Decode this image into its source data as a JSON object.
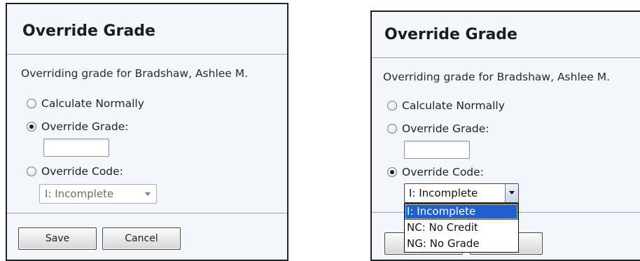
{
  "dialog_left": {
    "title": "Override Grade",
    "description": "Overriding grade for Bradshaw, Ashlee M.",
    "options": [
      {
        "label": "Calculate Normally",
        "checked": false
      },
      {
        "label": "Override Grade:",
        "checked": true
      },
      {
        "label": "Override Code:",
        "checked": false
      }
    ],
    "grade_value": "",
    "code_selected": "I: Incomplete",
    "save_label": "Save",
    "cancel_label": "Cancel"
  },
  "dialog_right": {
    "title": "Override Grade",
    "description": "Overriding grade for Bradshaw, Ashlee M.",
    "options": [
      {
        "label": "Calculate Normally",
        "checked": false
      },
      {
        "label": "Override Grade:",
        "checked": false
      },
      {
        "label": "Override Code:",
        "checked": true
      }
    ],
    "grade_value": "",
    "code_selected": "I: Incomplete",
    "dropdown_options": [
      "I: Incomplete",
      "NC: No Credit",
      "NG: No Grade"
    ],
    "dropdown_highlighted": "I: Incomplete",
    "save_label": "",
    "cancel_label": ""
  },
  "colors": {
    "dialog_bg": "#f3f6fa",
    "highlight": "#1f5fd0"
  }
}
